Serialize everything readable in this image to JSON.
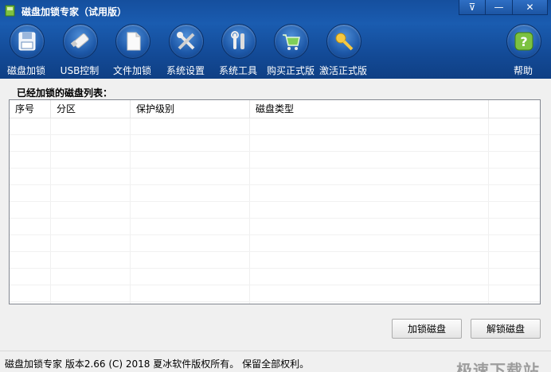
{
  "window": {
    "title": "磁盘加锁专家（试用版）",
    "buttons": {
      "menu": "⊽",
      "minimize": "—",
      "close": "✕"
    }
  },
  "toolbar": {
    "items": [
      {
        "label": "磁盘加锁",
        "icon": "disk-lock-icon"
      },
      {
        "label": "USB控制",
        "icon": "usb-icon"
      },
      {
        "label": "文件加锁",
        "icon": "file-lock-icon"
      },
      {
        "label": "系统设置",
        "icon": "settings-tools-icon"
      },
      {
        "label": "系统工具",
        "icon": "wrench-tools-icon"
      },
      {
        "label": "购买正式版",
        "icon": "shopping-cart-icon"
      },
      {
        "label": "激活正式版",
        "icon": "key-icon"
      },
      {
        "label": "帮助",
        "icon": "help-icon"
      }
    ]
  },
  "list": {
    "caption": "已经加锁的磁盘列表：",
    "columns": [
      "序号",
      "分区",
      "保护级别",
      "磁盘类型",
      ""
    ],
    "rows": []
  },
  "actions": {
    "lock": "加锁磁盘",
    "unlock": "解锁磁盘"
  },
  "status": {
    "text": "磁盘加锁专家  版本2.66  (C)   2018 夏冰软件版权所有。  保留全部权利。",
    "watermark": "极速下载站"
  },
  "colors": {
    "header": "#154f9e",
    "window_bg": "#f0f0f0",
    "border": "#828790"
  }
}
